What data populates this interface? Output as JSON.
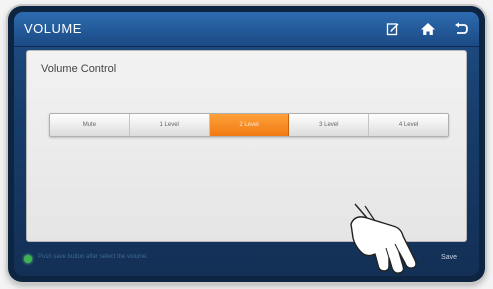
{
  "header": {
    "title": "VOLUME",
    "icons": [
      "edit-icon",
      "home-icon",
      "back-icon"
    ]
  },
  "main": {
    "section_label": "Volume Control",
    "levels": [
      {
        "label": "Mute",
        "selected": false
      },
      {
        "label": "1 Level",
        "selected": false
      },
      {
        "label": "2 Level",
        "selected": true
      },
      {
        "label": "3 Level",
        "selected": false
      },
      {
        "label": "4 Level",
        "selected": false
      }
    ]
  },
  "footer": {
    "hint": "Push save button after select the volume.",
    "save_label": "Save"
  },
  "colors": {
    "accent": "#f07a14",
    "titlebar": "#1b4a84",
    "status_dot": "#3fb34f"
  }
}
